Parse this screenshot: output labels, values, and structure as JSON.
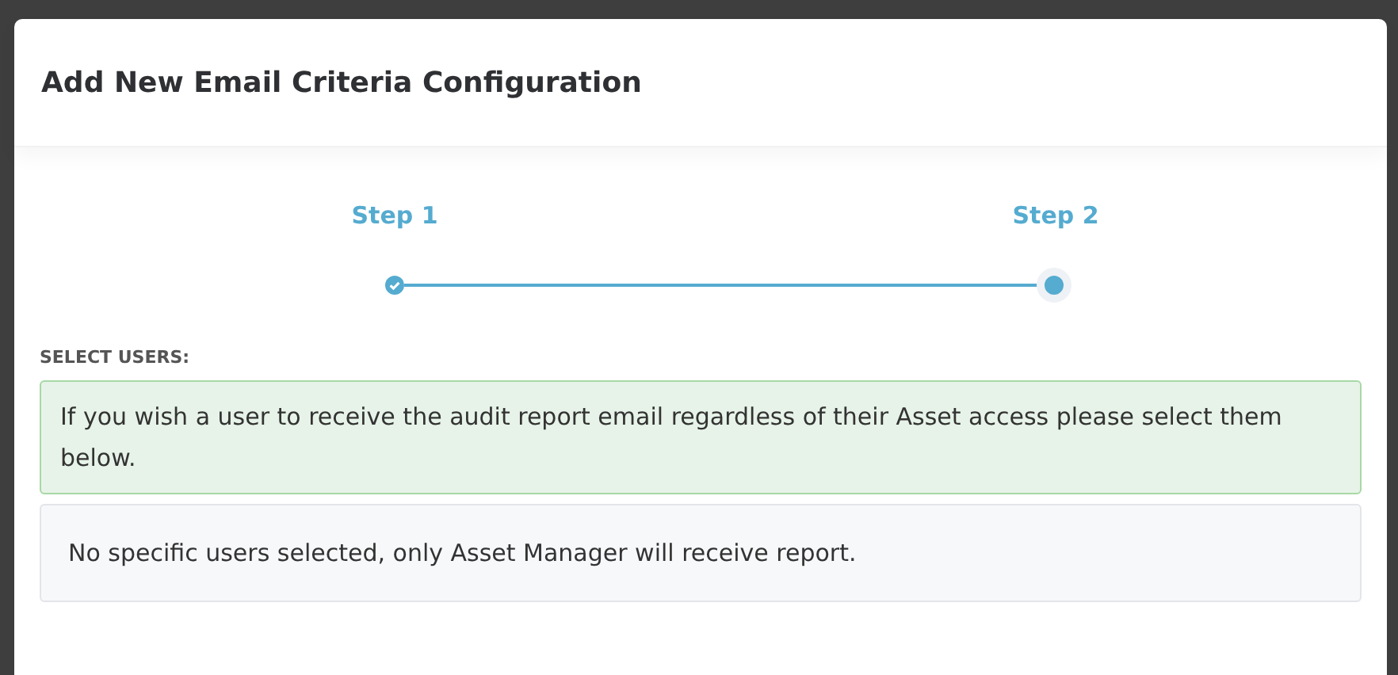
{
  "modal": {
    "title": "Add New Email Criteria Configuration",
    "steps": [
      {
        "label": "Step 1",
        "completed": true,
        "selected": false
      },
      {
        "label": "Step 2",
        "completed": false,
        "selected": true
      }
    ],
    "section_label": "SELECT USERS:",
    "info_message": "If you wish a user to receive the audit report email regardless of their Asset access please select them below.",
    "empty_message": "No specific users selected, only Asset Manager will receive report."
  }
}
